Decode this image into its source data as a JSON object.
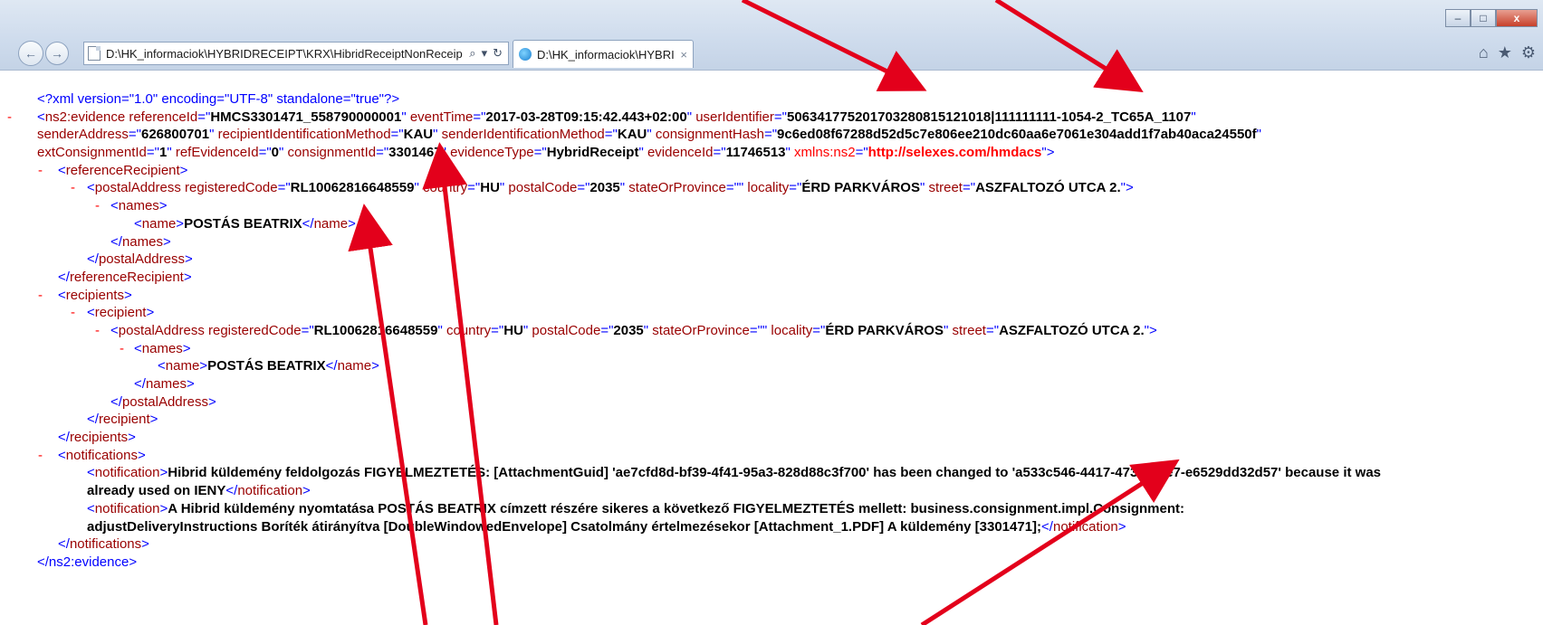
{
  "window": {
    "minimize_glyph": "–",
    "maximize_glyph": "□",
    "close_glyph": "x"
  },
  "nav": {
    "back_icon": "←",
    "forward_icon": "→"
  },
  "address_bar": {
    "url": "D:\\HK_informaciok\\HYBRIDRECEIPT\\KRX\\HibridReceiptNonReceip",
    "search_icon": "⌕",
    "dropdown_icon": "▾",
    "refresh_icon": "↻"
  },
  "tab": {
    "title": "D:\\HK_informaciok\\HYBRI...",
    "close_icon": "×"
  },
  "toolbar_icons": {
    "home": "⌂",
    "favorites": "★",
    "tools": "⚙"
  },
  "xml": {
    "decl": "<?xml version=\"1.0\" encoding=\"UTF-8\" standalone=\"true\"?>",
    "root_open": "<ns2:evidence",
    "root_close": "</ns2:evidence>",
    "evidence_attrs": {
      "referenceId": "HMCS3301471_558790000001",
      "eventTime": "2017-03-28T09:15:42.443+02:00",
      "userIdentifier": "5063417752017032808151210181111111111-1054-2_TC65A_1107",
      "userIdentifier_display": "506341775201703280815121018|111111111-1054-2_TC65A_1107",
      "senderAddress": "626800701",
      "recipientIdentificationMethod": "KAU",
      "senderIdentificationMethod": "KAU",
      "consignmentHash": "9c6ed08f67288d52d5c7e806ee210dc60aa6e7061e304add1f7ab40aca24550f",
      "extConsignmentId": "1",
      "refEvidenceId": "0",
      "consignmentId": "3301467",
      "evidenceType": "HybridReceipt",
      "evidenceId": "11746513",
      "xmlns_ns2": "http://selexes.com/hmdacs"
    },
    "tags": {
      "referenceRecipient_open": "<referenceRecipient>",
      "referenceRecipient_close": "</referenceRecipient>",
      "postalAddress_open": "<postalAddress",
      "postalAddress_close": "</postalAddress>",
      "names_open": "<names>",
      "names_close": "</names>",
      "name_open": "<name>",
      "name_close": "</name>",
      "recipients_open": "<recipients>",
      "recipients_close": "</recipients>",
      "recipient_open": "<recipient>",
      "recipient_close": "</recipient>",
      "notifications_open": "<notifications>",
      "notifications_close": "</notifications>",
      "notification_open": "<notification>",
      "notification_close": "</notification>"
    },
    "postal_address": {
      "registeredCode": "RL10062816648559",
      "country": "HU",
      "postalCode": "2035",
      "stateOrProvince": "",
      "locality": "ÉRD PARKVÁROS",
      "street": "ASZFALTOZÓ UTCA 2."
    },
    "name": "POSTÁS BEATRIX",
    "notifications": [
      "Hibrid küldemény feldolgozás FIGYELMEZTETÉS: [AttachmentGuid] 'ae7cfd8d-bf39-4f41-95a3-828d88c3f700' has been changed to 'a533c546-4417-473b-a9e7-e6529dd32d57' because it was already used on IENY",
      "A Hibrid küldemény nyomtatása POSTÁS BEATRIX címzett részére sikeres a következő FIGYELMEZTETÉS mellett: business.consignment.impl.Consignment: adjustDeliveryInstructions Boríték átirányítva [DoubleWindowedEnvelope] Csatolmány értelmezésekor [Attachment_1.PDF] A küldemény [3301471];"
    ],
    "collapse_marker": "-"
  },
  "colors": {
    "tag": "#990000",
    "pi": "#0000ff",
    "namespace": "#ff0000",
    "arrow": "#e3001b"
  }
}
